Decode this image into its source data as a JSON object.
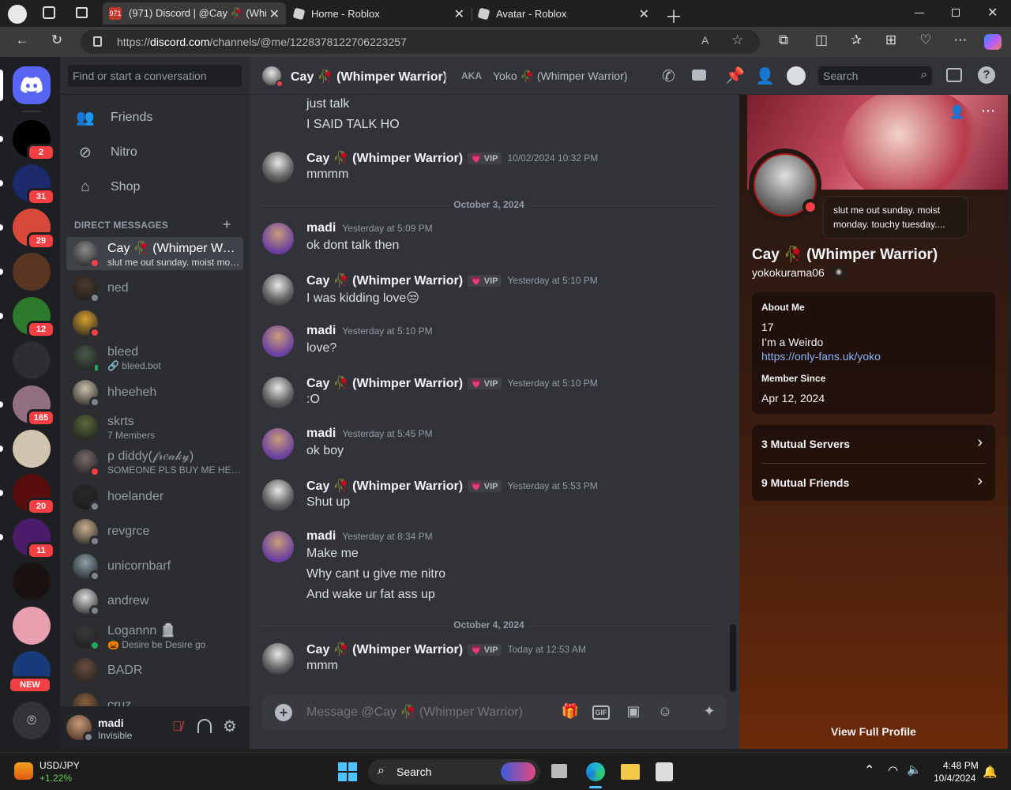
{
  "browser": {
    "tabs": [
      {
        "label": "(971) Discord | @Cay 🥀 (Whimper Warrior)",
        "favicon_badge": "971",
        "active": true
      },
      {
        "label": "Home - Roblox",
        "active": false
      },
      {
        "label": "Avatar - Roblox",
        "active": false
      }
    ],
    "url_prefix": "https://",
    "url_host": "discord.com",
    "url_path": "/channels/@me/1228378122706223257"
  },
  "servers": [
    {
      "name": "RL server",
      "badge": "2",
      "color": "#000000"
    },
    {
      "name": "Lyr server",
      "badge": "31",
      "color": "#1b2a6b"
    },
    {
      "name": "Cartoon server",
      "badge": "29",
      "color": "#d9493a"
    },
    {
      "name": "Sackboy server",
      "badge": "",
      "color": "#5a3622"
    },
    {
      "name": "Green server",
      "badge": "12",
      "color": "#2c7a2c"
    },
    {
      "name": "Robot server",
      "badge": "",
      "color": "#2b2d31"
    },
    {
      "name": "Icons server",
      "badge": "165",
      "color": "#8f6f80"
    },
    {
      "name": "Cat server",
      "badge": "",
      "color": "#cfc4b0"
    },
    {
      "name": "Red server",
      "badge": "20",
      "color": "#5a0d0d"
    },
    {
      "name": "Purple server",
      "badge": "11",
      "color": "#4a1b6b"
    },
    {
      "name": "Dark server",
      "badge": "",
      "color": "#1a1210"
    },
    {
      "name": "Pink server",
      "badge": "",
      "color": "#e8a0b0"
    },
    {
      "name": "New server",
      "badge": "NEW",
      "color": "#173a7a"
    }
  ],
  "dm_sidebar": {
    "search_placeholder": "Find or start a conversation",
    "nav": [
      "Friends",
      "Nitro",
      "Shop"
    ],
    "header": "DIRECT MESSAGES",
    "dms": [
      {
        "name": "Cay 🥀 (Whimper Warrior)",
        "sub": "slut me out sunday. moist monday. touchy tuesday.",
        "status": "dnd",
        "color": "#8b8b8b"
      },
      {
        "name": "ned",
        "sub": "",
        "status": "off",
        "color": "#4a3a2a"
      },
      {
        "name": "",
        "sub": "",
        "status": "dnd",
        "color": "#d8a030"
      },
      {
        "name": "bleed",
        "sub": "🔗 bleed.bot",
        "status": "mob",
        "color": "#4b5a4a"
      },
      {
        "name": "hheeheh",
        "sub": "",
        "status": "off",
        "color": "#c9c0a8"
      },
      {
        "name": "skrts",
        "sub": "7 Members",
        "status": "",
        "color": "#5a6a3a"
      },
      {
        "name": "p diddy(𝒻𝓇𝑒𝒶𝓀𝓎)",
        "sub": "SOMEONE PLS BUY ME HEADPHONES",
        "status": "dnd",
        "color": "#7a6a6a"
      },
      {
        "name": "hoelander",
        "sub": "",
        "status": "off",
        "color": "#2a2a2a"
      },
      {
        "name": "revgrce",
        "sub": "",
        "status": "off",
        "color": "#c9b090"
      },
      {
        "name": "unicornbarf",
        "sub": "",
        "status": "off",
        "color": "#8aa0a8"
      },
      {
        "name": "andrew",
        "sub": "",
        "status": "off",
        "color": "#dcdcdc"
      },
      {
        "name": "Logannn 🪦",
        "sub": "🎃 Desire be Desire go",
        "status": "on",
        "color": "#3a3a3a"
      },
      {
        "name": "BADR",
        "sub": "",
        "status": "",
        "color": "#6a5040"
      },
      {
        "name": "cruz",
        "sub": "",
        "status": "",
        "color": "#8a6040"
      }
    ]
  },
  "user_panel": {
    "name": "madi",
    "status": "Invisible"
  },
  "chat_header": {
    "name": "Cay 🥀 (Whimper Warrior)",
    "aka_label": "AKA",
    "aka_value": "Yoko 🥀 (Whimper Warrior)",
    "search_placeholder": "Search"
  },
  "messages": {
    "top_lines": [
      "just talk",
      "I SAID TALK HO"
    ],
    "dividers": [
      "October 3, 2024",
      "October 4, 2024"
    ],
    "groups": [
      {
        "author": "Cay 🥀 (Whimper Warrior)",
        "vip": "💗 VIP",
        "time": "10/02/2024 10:32 PM",
        "lines": [
          "mmmm"
        ],
        "who": "cay"
      },
      {
        "author": "madi",
        "vip": "",
        "time": "Yesterday at 5:09 PM",
        "lines": [
          "ok dont talk then"
        ],
        "who": "madi"
      },
      {
        "author": "Cay 🥀 (Whimper Warrior)",
        "vip": "💗 VIP",
        "time": "Yesterday at 5:10 PM",
        "lines": [
          "I was kidding love😒"
        ],
        "who": "cay"
      },
      {
        "author": "madi",
        "vip": "",
        "time": "Yesterday at 5:10 PM",
        "lines": [
          "love?"
        ],
        "who": "madi"
      },
      {
        "author": "Cay 🥀 (Whimper Warrior)",
        "vip": "💗 VIP",
        "time": "Yesterday at 5:10 PM",
        "lines": [
          ":O"
        ],
        "who": "cay"
      },
      {
        "author": "madi",
        "vip": "",
        "time": "Yesterday at 5:45 PM",
        "lines": [
          "ok boy"
        ],
        "who": "madi"
      },
      {
        "author": "Cay 🥀 (Whimper Warrior)",
        "vip": "💗 VIP",
        "time": "Yesterday at 5:53 PM",
        "lines": [
          "Shut up"
        ],
        "who": "cay"
      },
      {
        "author": "madi",
        "vip": "",
        "time": "Yesterday at 8:34 PM",
        "lines": [
          "Make me",
          "Why cant u give me nitro",
          "And wake ur fat ass up"
        ],
        "who": "madi"
      },
      {
        "author": "Cay 🥀 (Whimper Warrior)",
        "vip": "💗 VIP",
        "time": "Today at 12:53 AM",
        "lines": [
          "mmm"
        ],
        "who": "cay"
      }
    ]
  },
  "composer": {
    "placeholder": "Message @Cay 🥀 (Whimper Warrior)",
    "gif_label": "GIF"
  },
  "profile": {
    "status_bubble": "slut me out sunday. moist monday. touchy tuesday....",
    "display_name": "Cay 🥀 (Whimper Warrior)",
    "username": "yokokurama06",
    "about_label": "About Me",
    "about_lines": [
      "17",
      "I’m a Weirdo"
    ],
    "about_link": "https://only-fans.uk/yoko",
    "member_since_label": "Member Since",
    "member_since": "Apr 12, 2024",
    "mutual_servers": "3 Mutual Servers",
    "mutual_friends": "9 Mutual Friends",
    "view_full": "View Full Profile"
  },
  "taskbar": {
    "ticker_name": "USD/JPY",
    "ticker_change": "+1.22%",
    "search_label": "Search",
    "time": "4:48 PM",
    "date": "10/4/2024"
  },
  "colors": {
    "blurple": "#5865f2",
    "dnd": "#f23f43",
    "online": "#23a55a",
    "link": "#00a8fc"
  }
}
